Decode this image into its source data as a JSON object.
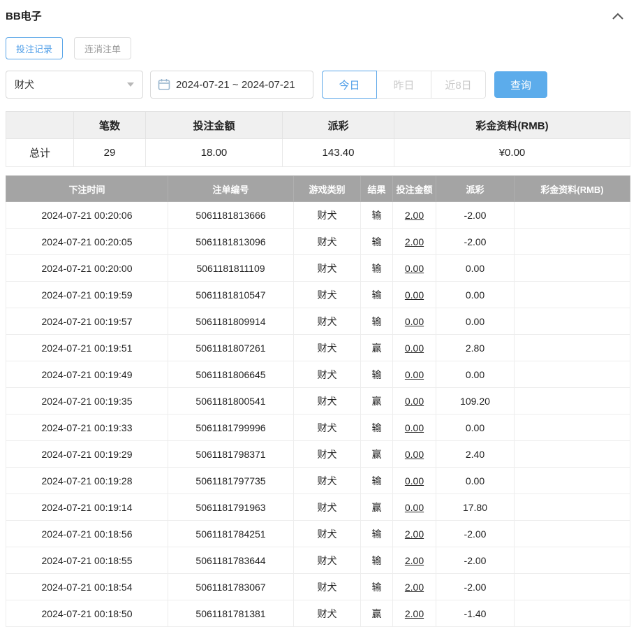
{
  "header": {
    "title": "BB电子"
  },
  "tabs": [
    {
      "label": "投注记录",
      "active": true
    },
    {
      "label": "连消注单",
      "active": false
    }
  ],
  "filters": {
    "game_select_value": "财犬",
    "date_range_value": "2024-07-21 ~ 2024-07-21",
    "quick_buttons": [
      {
        "label": "今日",
        "active": true
      },
      {
        "label": "昨日",
        "active": false
      },
      {
        "label": "近8日",
        "active": false
      }
    ],
    "search_label": "查询"
  },
  "summary": {
    "headers": [
      "",
      "笔数",
      "投注金额",
      "派彩",
      "彩金资料(RMB)"
    ],
    "row_label": "总计",
    "count": "29",
    "bet_amount": "18.00",
    "payout": "143.40",
    "bonus": "¥0.00"
  },
  "table": {
    "headers": [
      "下注时间",
      "注单编号",
      "游戏类别",
      "结果",
      "投注金额",
      "派彩",
      "彩金资料(RMB)"
    ],
    "rows": [
      {
        "time": "2024-07-21 00:20:06",
        "order_id": "5061181813666",
        "game": "财犬",
        "result": "输",
        "bet": "2.00",
        "payout": "-2.00",
        "bonus": ""
      },
      {
        "time": "2024-07-21 00:20:05",
        "order_id": "5061181813096",
        "game": "财犬",
        "result": "输",
        "bet": "2.00",
        "payout": "-2.00",
        "bonus": ""
      },
      {
        "time": "2024-07-21 00:20:00",
        "order_id": "5061181811109",
        "game": "财犬",
        "result": "输",
        "bet": "0.00",
        "payout": "0.00",
        "bonus": ""
      },
      {
        "time": "2024-07-21 00:19:59",
        "order_id": "5061181810547",
        "game": "财犬",
        "result": "输",
        "bet": "0.00",
        "payout": "0.00",
        "bonus": ""
      },
      {
        "time": "2024-07-21 00:19:57",
        "order_id": "5061181809914",
        "game": "财犬",
        "result": "输",
        "bet": "0.00",
        "payout": "0.00",
        "bonus": ""
      },
      {
        "time": "2024-07-21 00:19:51",
        "order_id": "5061181807261",
        "game": "财犬",
        "result": "赢",
        "bet": "0.00",
        "payout": "2.80",
        "bonus": ""
      },
      {
        "time": "2024-07-21 00:19:49",
        "order_id": "5061181806645",
        "game": "财犬",
        "result": "输",
        "bet": "0.00",
        "payout": "0.00",
        "bonus": ""
      },
      {
        "time": "2024-07-21 00:19:35",
        "order_id": "5061181800541",
        "game": "财犬",
        "result": "赢",
        "bet": "0.00",
        "payout": "109.20",
        "bonus": ""
      },
      {
        "time": "2024-07-21 00:19:33",
        "order_id": "5061181799996",
        "game": "财犬",
        "result": "输",
        "bet": "0.00",
        "payout": "0.00",
        "bonus": ""
      },
      {
        "time": "2024-07-21 00:19:29",
        "order_id": "5061181798371",
        "game": "财犬",
        "result": "赢",
        "bet": "0.00",
        "payout": "2.40",
        "bonus": ""
      },
      {
        "time": "2024-07-21 00:19:28",
        "order_id": "5061181797735",
        "game": "财犬",
        "result": "输",
        "bet": "0.00",
        "payout": "0.00",
        "bonus": ""
      },
      {
        "time": "2024-07-21 00:19:14",
        "order_id": "5061181791963",
        "game": "财犬",
        "result": "赢",
        "bet": "0.00",
        "payout": "17.80",
        "bonus": ""
      },
      {
        "time": "2024-07-21 00:18:56",
        "order_id": "5061181784251",
        "game": "财犬",
        "result": "输",
        "bet": "2.00",
        "payout": "-2.00",
        "bonus": ""
      },
      {
        "time": "2024-07-21 00:18:55",
        "order_id": "5061181783644",
        "game": "财犬",
        "result": "输",
        "bet": "2.00",
        "payout": "-2.00",
        "bonus": ""
      },
      {
        "time": "2024-07-21 00:18:54",
        "order_id": "5061181783067",
        "game": "财犬",
        "result": "输",
        "bet": "2.00",
        "payout": "-2.00",
        "bonus": ""
      },
      {
        "time": "2024-07-21 00:18:50",
        "order_id": "5061181781381",
        "game": "财犬",
        "result": "赢",
        "bet": "2.00",
        "payout": "-1.40",
        "bonus": ""
      }
    ]
  },
  "colors": {
    "accent_blue": "#5caceb",
    "link_blue": "#5ba8ea",
    "negative_red": "#e45b5b",
    "table_header_gray": "#a4a4a4",
    "summary_header_gray": "#f0f0f0"
  }
}
